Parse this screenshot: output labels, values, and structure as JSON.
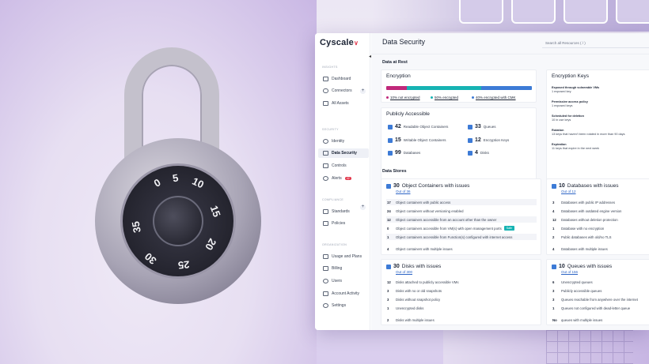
{
  "app": {
    "brand": "Cyscale",
    "page_title": "Data Security",
    "search_placeholder": "Search all Resources ( / )"
  },
  "colors": {
    "accent": "#3d7bd6",
    "brand_red": "#e2364a",
    "teal": "#16b3b3",
    "magenta": "#c0287a"
  },
  "sidebar": {
    "sections": [
      {
        "label": "INSIGHTS",
        "items": [
          {
            "label": "Dashboard",
            "icon": "monitor-icon"
          },
          {
            "label": "Connectors",
            "icon": "cloud-icon"
          },
          {
            "label": "All Assets",
            "icon": "layers-icon"
          }
        ]
      },
      {
        "label": "SECURITY",
        "items": [
          {
            "label": "Identity",
            "icon": "eye-icon"
          },
          {
            "label": "Data Security",
            "icon": "database-icon"
          },
          {
            "label": "Controls",
            "icon": "controls-icon"
          },
          {
            "label": "Alerts",
            "icon": "alert-icon",
            "badge": "42"
          }
        ]
      },
      {
        "label": "COMPLIANCE",
        "items": [
          {
            "label": "Standards",
            "icon": "flag-icon"
          },
          {
            "label": "Policies",
            "icon": "policy-icon"
          }
        ]
      },
      {
        "label": "ORGANIZATION",
        "items": [
          {
            "label": "Usage and Plans",
            "icon": "chart-icon"
          },
          {
            "label": "Billing",
            "icon": "card-icon"
          },
          {
            "label": "Users",
            "icon": "users-icon"
          },
          {
            "label": "Account Activity",
            "icon": "activity-icon"
          },
          {
            "label": "Settings",
            "icon": "gear-icon"
          }
        ]
      }
    ]
  },
  "data_at_rest": {
    "label": "Data at Rest",
    "encryption": {
      "title": "Encryption",
      "segments": [
        {
          "pct": 10,
          "color": "#c0287a"
        },
        {
          "pct": 50,
          "color": "#16b3b3"
        },
        {
          "pct": 40,
          "color": "#3d7bd6"
        }
      ],
      "legend": [
        "10% not encrypted",
        "50% encrypted",
        "40% encrypted with CMK"
      ]
    },
    "publicly_accessible": {
      "title": "Publicly Accessible",
      "stats": [
        {
          "value": "42",
          "label": "Readable Object Containers"
        },
        {
          "value": "33",
          "label": "Queues"
        },
        {
          "value": "15",
          "label": "Writable Object Containers"
        },
        {
          "value": "12",
          "label": "Encryption Keys"
        },
        {
          "value": "99",
          "label": "Databases"
        },
        {
          "value": "4",
          "label": "Disks"
        }
      ]
    },
    "encryption_keys": {
      "title": "Encryption Keys",
      "items": [
        {
          "title": "Exposed through vulnerable VMs",
          "sub": "1 exposed key"
        },
        {
          "title": "Permissive access policy",
          "sub": "1 exposed keys"
        },
        {
          "title": "Scheduled for deletion",
          "sub": "10 in use keys"
        },
        {
          "title": "Rotation",
          "sub": "13 keys that haven't been rotated in more than 90 days"
        },
        {
          "title": "Expiration",
          "sub": "11 keys that expire in the next week"
        }
      ]
    }
  },
  "data_stores": {
    "label": "Data Stores",
    "object_containers": {
      "count": "30",
      "title": "Object Containers with issues",
      "out_of": "Out of 36",
      "rows": [
        {
          "n": "17",
          "text": "Object containers with public access"
        },
        {
          "n": "24",
          "text": "Object containers without versioning enabled"
        },
        {
          "n": "12",
          "text": "Object containers accessible from an account other than the owner"
        },
        {
          "n": "0",
          "text": "Object containers accessible from VM(s) with open management ports",
          "badge": "Safe"
        },
        {
          "n": "1",
          "text": "Object containers accessible from Function(s) configured with internet access"
        },
        {
          "n": "4",
          "text": "Object containers with multiple issues"
        }
      ]
    },
    "databases": {
      "count": "10",
      "title": "Databases with issues",
      "out_of": "Out of 12",
      "rows": [
        {
          "n": "3",
          "text": "Databases with public IP addresses"
        },
        {
          "n": "4",
          "text": "Databases with outdated engine version"
        },
        {
          "n": "12",
          "text": "Databases without deletion protection"
        },
        {
          "n": "1",
          "text": "Database with no encryption"
        },
        {
          "n": "2",
          "text": "Public databases with old/no TLS"
        },
        {
          "n": "4",
          "text": "Databases with multiple issues"
        }
      ]
    },
    "disks": {
      "count": "30",
      "title": "Disks with issues",
      "out_of": "Out of 300",
      "rows": [
        {
          "n": "12",
          "text": "Disks attached to publicly accessible VMs"
        },
        {
          "n": "3",
          "text": "Disks with no or old snapshots"
        },
        {
          "n": "3",
          "text": "Disks without snapshot policy"
        },
        {
          "n": "1",
          "text": "Unencrypted disks"
        },
        {
          "n": "2",
          "text": "Disks with multiple issues"
        }
      ]
    },
    "queues": {
      "count": "10",
      "title": "Queues with issues",
      "out_of": "Out of 156",
      "rows": [
        {
          "n": "6",
          "text": "Unencrypted queues"
        },
        {
          "n": "3",
          "text": "Publicly accessible queues"
        },
        {
          "n": "3",
          "text": "Queues reachable from anywhere over the internet"
        },
        {
          "n": "1",
          "text": "Queues not configured with dead-letter queue"
        },
        {
          "n": "No",
          "text": "queues with multiple issues"
        }
      ]
    }
  },
  "lock_dial_numbers": [
    "5",
    "0",
    "10",
    "15",
    "20",
    "25",
    "30",
    "35"
  ]
}
